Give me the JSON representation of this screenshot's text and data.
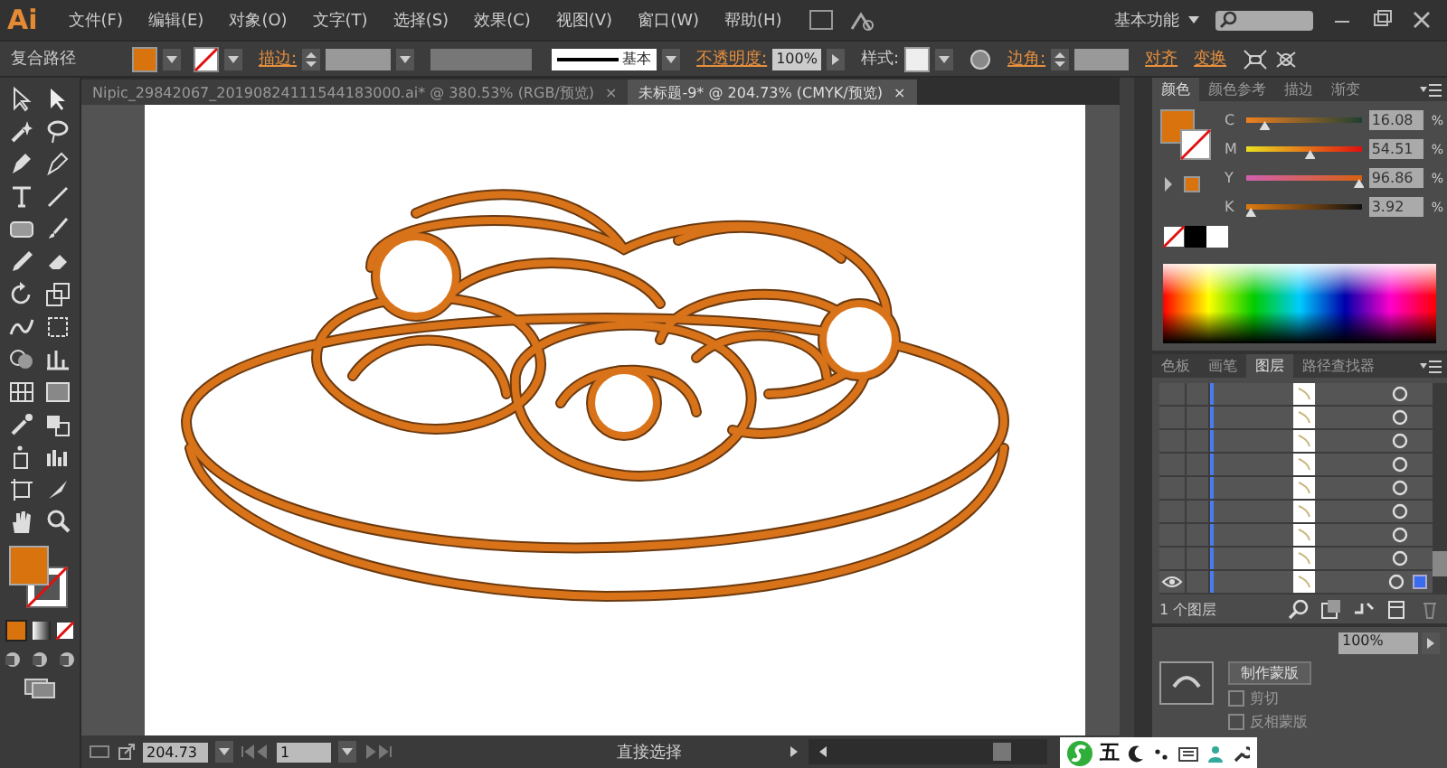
{
  "menu_bar": {
    "logo": "Ai",
    "items": [
      "文件(F)",
      "编辑(E)",
      "对象(O)",
      "文字(T)",
      "选择(S)",
      "效果(C)",
      "视图(V)",
      "窗口(W)",
      "帮助(H)"
    ],
    "workspace": "基本功能"
  },
  "control_bar": {
    "selection": "复合路径",
    "stroke_label": "描边:",
    "stroke_profile": "基本",
    "opacity_label": "不透明度:",
    "opacity": "100%",
    "style_label": "样式:",
    "corner_label": "边角:",
    "align": "对齐",
    "transform": "变换"
  },
  "document_tabs": [
    {
      "title": "Nipic_29842067_20190824111544183000.ai* @ 380.53% (RGB/预览)",
      "close": "×",
      "selected": false
    },
    {
      "title": "未标题-9* @ 204.73% (CMYK/预览)",
      "close": "×",
      "selected": true
    }
  ],
  "color_panel": {
    "tabs": [
      {
        "label": "颜色",
        "selected": true
      },
      {
        "label": "颜色参考",
        "selected": false
      },
      {
        "label": "描边",
        "selected": false
      },
      {
        "label": "渐变",
        "selected": false
      }
    ],
    "channels": [
      {
        "name": "C",
        "level": 0.16,
        "value": "16.08",
        "unit": "%"
      },
      {
        "name": "M",
        "level": 0.55,
        "value": "54.51",
        "unit": "%"
      },
      {
        "name": "Y",
        "level": 0.97,
        "value": "96.86",
        "unit": "%"
      },
      {
        "name": "K",
        "level": 0.04,
        "value": "3.92",
        "unit": "%"
      }
    ]
  },
  "layers_panel": {
    "tabs": [
      {
        "label": "色板",
        "selected": false
      },
      {
        "label": "画笔",
        "selected": false
      },
      {
        "label": "图层",
        "selected": true
      },
      {
        "label": "路径查找器",
        "selected": false
      }
    ],
    "rows": [
      {
        "visible": false,
        "selected": false
      },
      {
        "visible": false,
        "selected": false
      },
      {
        "visible": false,
        "selected": false
      },
      {
        "visible": false,
        "selected": false
      },
      {
        "visible": false,
        "selected": false
      },
      {
        "visible": false,
        "selected": false
      },
      {
        "visible": false,
        "selected": false
      },
      {
        "visible": false,
        "selected": false
      },
      {
        "visible": true,
        "selected": true
      }
    ],
    "count": "1 个图层"
  },
  "transparency_panel": {
    "opacity": "100%",
    "make_mask": "制作蒙版",
    "options": [
      {
        "label": "剪切",
        "checked": false
      },
      {
        "label": "反相蒙版",
        "checked": false
      }
    ]
  },
  "status_bar": {
    "zoom": "204.73",
    "page": "1",
    "tool": "直接选择"
  },
  "ime_toolbar": {
    "mode": "五"
  }
}
